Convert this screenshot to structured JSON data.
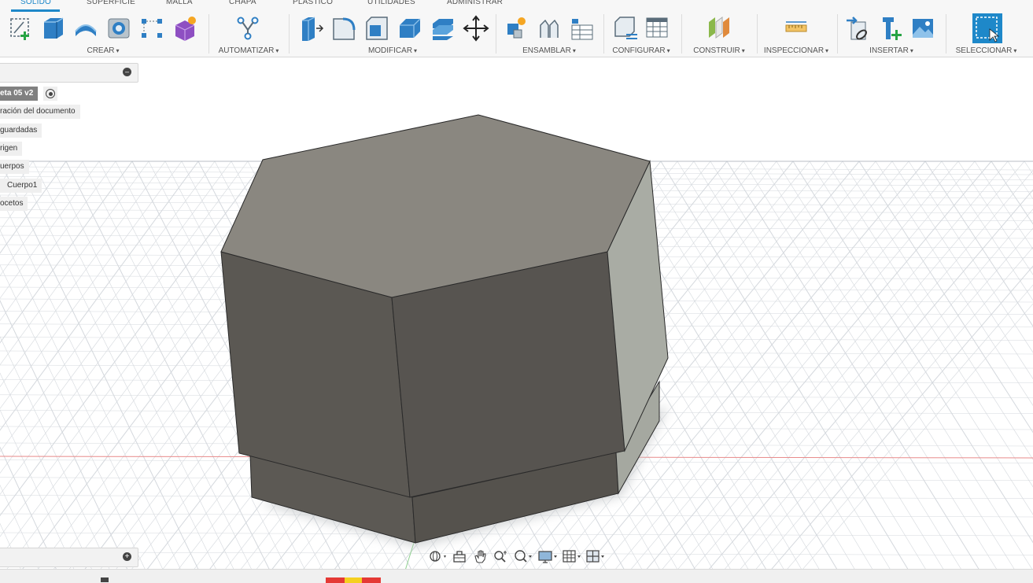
{
  "tabs": [
    {
      "label": "SÓLIDO",
      "active": true
    },
    {
      "label": "SUPERFICIE",
      "active": false
    },
    {
      "label": "MALLA",
      "active": false
    },
    {
      "label": "CHAPA",
      "active": false
    },
    {
      "label": "PLÁSTICO",
      "active": false
    },
    {
      "label": "UTILIDADES",
      "active": false
    },
    {
      "label": "ADMINISTRAR",
      "active": false
    }
  ],
  "groups": {
    "crear": "CREAR",
    "automatizar": "AUTOMATIZAR",
    "modificar": "MODIFICAR",
    "ensamblar": "ENSAMBLAR",
    "configurar": "CONFIGURAR",
    "construir": "CONSTRUIR",
    "inspeccionar": "INSPECCIONAR",
    "insertar": "INSERTAR",
    "seleccionar": "SELECCIONAR"
  },
  "caret": "▾",
  "browser": {
    "root": "eta 05 v2",
    "items": [
      "ración del documento",
      "guardadas",
      "rigen",
      "uerpos",
      "Cuerpo1",
      "ocetos"
    ],
    "collapse_glyph": "–"
  },
  "comments": {
    "expand_glyph": "+"
  },
  "colors": {
    "accent": "#1e88c9",
    "body_top": "#8a8780",
    "body_front": "#5a5752",
    "body_right": "#a6a8a1",
    "grid": "#d4d8dd"
  },
  "icons": {
    "navbar": [
      "orbit-icon",
      "look-at-icon",
      "pan-icon",
      "zoom-icon",
      "fit-icon",
      "display-settings-icon",
      "grid-settings-icon",
      "viewports-icon"
    ]
  }
}
